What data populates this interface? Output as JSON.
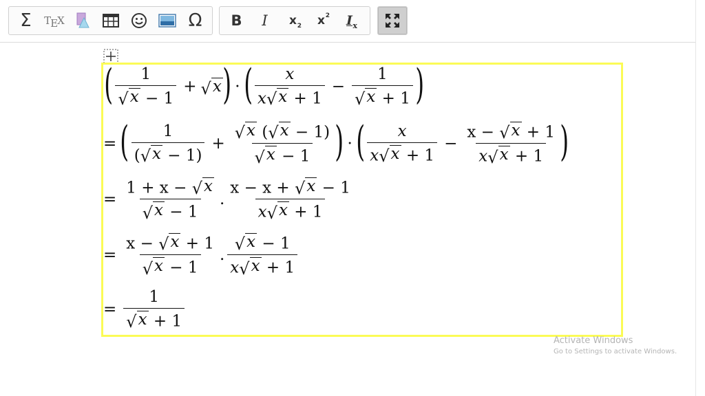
{
  "toolbar": {
    "group1": [
      "sigma-icon",
      "tex-icon",
      "shape-icon",
      "table-icon",
      "smiley-icon",
      "image-icon",
      "omega-icon"
    ],
    "sigma_glyph": "Σ",
    "tex_glyph_t": "T",
    "tex_glyph_e": "E",
    "tex_glyph_x": "X",
    "omega_glyph": "Ω",
    "bold_glyph": "B",
    "italic_glyph": "I",
    "subscript_glyph": "x",
    "subscript_small": "2",
    "superscript_glyph": "x",
    "superscript_small": "2",
    "clear_format_glyph": "I",
    "clear_format_small": "x"
  },
  "math": {
    "l1": {
      "f1_num": "1",
      "f1_den_rad": "x",
      "f1_den_rest": " − 1",
      "plus": "+",
      "sqrt_x": "x",
      "dot": "·",
      "f2_num": "x",
      "f2_den_pre": "x",
      "f2_den_rad": "x",
      "f2_den_rest": " + 1",
      "minus": "−",
      "f3_num": "1",
      "f3_den_rad": "x",
      "f3_den_rest": " + 1"
    },
    "l2": {
      "eq": "=",
      "f1_num": "1",
      "f1_den_open": "(",
      "f1_den_rad": "x",
      "f1_den_rest": " − 1)",
      "plus": "+",
      "f2_num_rad": "x",
      "f2_num_open": " (",
      "f2_num_rad2": "x",
      "f2_num_rest": " − 1)",
      "f2_den_rad": "x",
      "f2_den_rest": " − 1",
      "dot": "·",
      "f3_num": "x",
      "f3_den_pre": "x",
      "f3_den_rad": "x",
      "f3_den_rest": " + 1",
      "minus": "−",
      "f4_num_pre": "x − ",
      "f4_num_rad": "x",
      "f4_num_rest": " + 1",
      "f4_den_pre": "x",
      "f4_den_rad": "x",
      "f4_den_rest": " + 1"
    },
    "l3": {
      "eq": "=",
      "f1_num_pre": "1 + x − ",
      "f1_num_rad": "x",
      "f1_den_rad": "x",
      "f1_den_rest": " − 1",
      "dot": ".",
      "f2_num_pre": "x − x + ",
      "f2_num_rad": "x",
      "f2_num_rest": " − 1",
      "f2_den_pre": "x",
      "f2_den_rad": "x",
      "f2_den_rest": " + 1"
    },
    "l4": {
      "eq": "=",
      "f1_num_pre": "x − ",
      "f1_num_rad": "x",
      "f1_num_rest": " + 1",
      "f1_den_rad": "x",
      "f1_den_rest": " − 1",
      "dot": ".",
      "f2_num_rad": "x",
      "f2_num_rest": " − 1",
      "f2_den_pre": "x",
      "f2_den_rad": "x",
      "f2_den_rest": " + 1"
    },
    "l5": {
      "eq": "=",
      "f1_num": "1",
      "f1_den_rad": "x",
      "f1_den_rest": " + 1"
    }
  },
  "watermark": {
    "line1": "Activate Windows",
    "line2": "Go to Settings to activate Windows."
  },
  "colors": {
    "selection_border": "#fbfb55",
    "toolbar_border": "#cfcfcf",
    "active_button": "#cfcfcf"
  }
}
